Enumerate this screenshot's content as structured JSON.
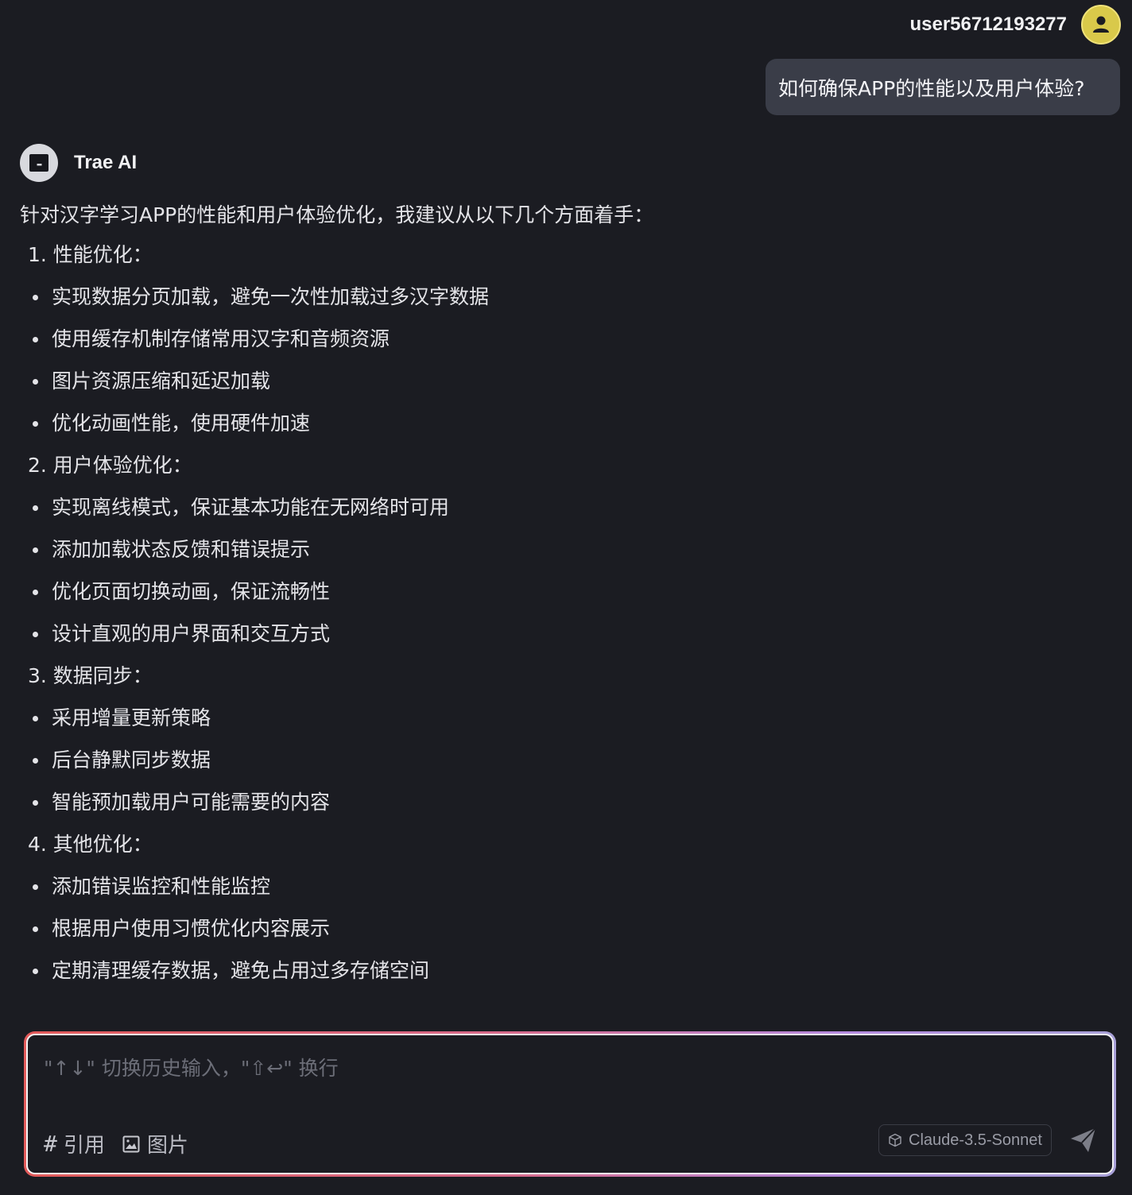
{
  "user": {
    "name": "user56712193277",
    "question": "如何确保APP的性能以及用户体验?"
  },
  "assistant": {
    "name": "Trae AI",
    "intro": "针对汉字学习APP的性能和用户体验优化，我建议从以下几个方面着手：",
    "sections": [
      {
        "heading": "1. 性能优化：",
        "items": [
          "实现数据分页加载，避免一次性加载过多汉字数据",
          "使用缓存机制存储常用汉字和音频资源",
          "图片资源压缩和延迟加载",
          "优化动画性能，使用硬件加速"
        ]
      },
      {
        "heading": "2. 用户体验优化：",
        "items": [
          "实现离线模式，保证基本功能在无网络时可用",
          "添加加载状态反馈和错误提示",
          "优化页面切换动画，保证流畅性",
          "设计直观的用户界面和交互方式"
        ]
      },
      {
        "heading": "3. 数据同步：",
        "items": [
          "采用增量更新策略",
          "后台静默同步数据",
          "智能预加载用户可能需要的内容"
        ]
      },
      {
        "heading": "4. 其他优化：",
        "items": [
          "添加错误监控和性能监控",
          "根据用户使用习惯优化内容展示",
          "定期清理缓存数据，避免占用过多存储空间"
        ]
      }
    ]
  },
  "composer": {
    "placeholder": "\"↑↓\" 切换历史输入，\"⇧↩\" 换行",
    "reference_label": "引用",
    "reference_symbol": "#",
    "image_label": "图片",
    "model": "Claude-3.5-Sonnet"
  },
  "colors": {
    "background": "#1b1c22",
    "user_bubble": "#3a3d48",
    "avatar": "#d9c94a",
    "border_gradient_start": "#e25a5a",
    "border_gradient_end": "#a8a0d8"
  },
  "icons": {
    "user_avatar": "person-icon",
    "assistant_avatar": "trae-logo-icon",
    "image": "image-icon",
    "model": "cube-icon",
    "send": "send-icon"
  }
}
